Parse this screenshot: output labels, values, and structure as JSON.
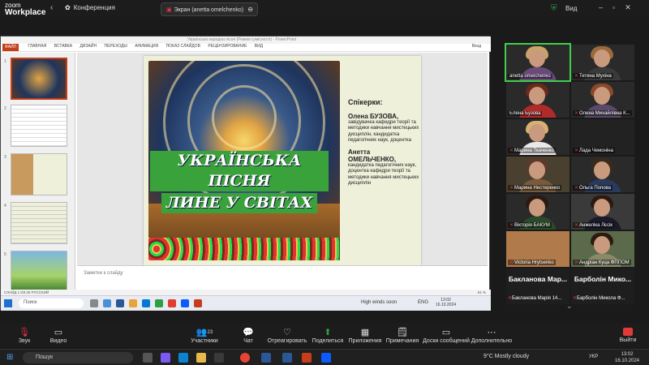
{
  "zoom": {
    "logo_line1": "zoom",
    "logo_line2": "Workplace",
    "conference_label": "Конференция",
    "share_indicator": "Экран (anetta omelchenko)",
    "view_label": "Вид"
  },
  "presentation": {
    "window_title": "Українська народна пісня (Режим сумісності) - PowerPoint",
    "ribbon_tabs": [
      "ФАЙЛ",
      "ГЛАВНАЯ",
      "ВСТАВКА",
      "ДИЗАЙН",
      "ПЕРЕХОДЫ",
      "АНИМАЦИЯ",
      "ПОКАЗ СЛАЙДОВ",
      "РЕЦЕНЗИРОВАНИЕ",
      "ВИД"
    ],
    "user_label": "Вход",
    "thumb_numbers": [
      "1",
      "2",
      "3",
      "4",
      "5"
    ],
    "slide": {
      "title_line1": "УКРАЇНСЬКА ПІСНЯ",
      "title_line2": "ЛИНЕ У СВІТАХ",
      "speakers_heading": "Спікерки:",
      "speaker1_name": "Олена БУЗОВА,",
      "speaker1_desc": "завідувачка кафедри теорії та методики навчання мистецьких дисциплін, кандидатка педагогічних наук, доцентка",
      "speaker2_name": "Анетта ОМЕЛЬЧЕНКО,",
      "speaker2_desc": "кандидатка педагогічних наук, доцентка кафедри теорії та методики навчання мистецьких дисциплін"
    },
    "notes_placeholder": "Заметки к слайду",
    "status_left": "СЛАЙД 1 ИЗ 26   РУССКИЙ",
    "status_right": "61 %",
    "inner_taskbar": {
      "search": "Поиск",
      "weather": "High winds soon",
      "lang": "ENG",
      "time": "13:02",
      "date": "16.10.2024"
    }
  },
  "participants": [
    {
      "name": "anetta omelchenko",
      "muted": false,
      "active": true
    },
    {
      "name": "Тетяна Мухіна",
      "muted": true,
      "active": false
    },
    {
      "name": "Елена Бузова",
      "muted": false,
      "active": false
    },
    {
      "name": "Олена Михайлівна К...",
      "muted": true,
      "active": false
    },
    {
      "name": "Марина Ткаченко",
      "muted": true,
      "active": false
    },
    {
      "name": "Лада Чемоніна",
      "muted": true,
      "active": false
    },
    {
      "name": "Марина Нестеренко",
      "muted": true,
      "active": false
    },
    {
      "name": "Ольга Попова",
      "muted": true,
      "active": false
    },
    {
      "name": "Вікторія БАКУМ",
      "muted": true,
      "active": false
    },
    {
      "name": "Анжеліка Лєсік",
      "muted": true,
      "active": false
    },
    {
      "name": "Victoria Hrytsenko",
      "muted": true,
      "active": false
    },
    {
      "name": "Андріан Куца ФППОМ",
      "muted": true,
      "active": false
    }
  ],
  "name_cards": [
    {
      "big": "Бакланова  Мар...",
      "small": "Бакланова Марія 14..."
    },
    {
      "big": "Барболін  Мико...",
      "small": "Барболін Микола Ф..."
    }
  ],
  "controls": {
    "audio": "Звук",
    "video": "Видео",
    "participants": "Участники",
    "participants_count": "23",
    "chat": "Чат",
    "react": "Отреагировать",
    "share": "Поделиться",
    "apps": "Приложения",
    "notes": "Примечания",
    "whiteboards": "Доски сообщений",
    "more": "Дополнительно",
    "leave": "Выйти"
  },
  "taskbar": {
    "search": "Пошук",
    "weather": "9°C  Mostly cloudy",
    "lang": "УКР",
    "time": "13:02",
    "date": "16.10.2024"
  },
  "colors": {
    "ppt_accent": "#c43e1c",
    "active_speaker": "#3ecf4c",
    "leave_red": "#e23a3a",
    "title_green": "#3aa23a"
  }
}
